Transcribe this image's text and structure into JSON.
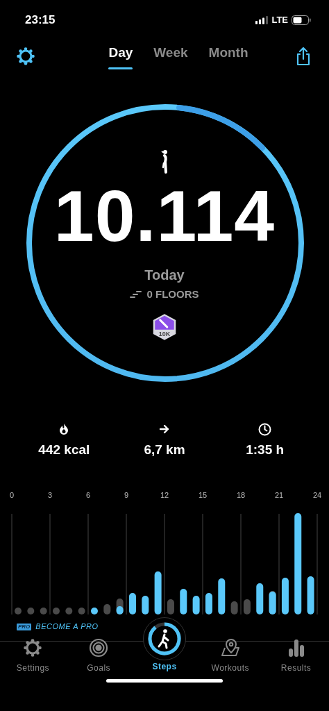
{
  "status_bar": {
    "time": "23:15",
    "network": "LTE"
  },
  "tabs": [
    {
      "label": "Day",
      "selected": true
    },
    {
      "label": "Week",
      "selected": false
    },
    {
      "label": "Month",
      "selected": false
    }
  ],
  "summary": {
    "steps": "10.114",
    "period": "Today",
    "floors": "0 FLOORS",
    "badge": "10K"
  },
  "stats": [
    {
      "kind": "energy",
      "value": "442 kcal"
    },
    {
      "kind": "distance",
      "value": "6,7 km"
    },
    {
      "kind": "time",
      "value": "1:35 h"
    }
  ],
  "hourly_chart": {
    "hour_labels": [
      "0",
      "3",
      "6",
      "9",
      "12",
      "15",
      "18",
      "21",
      "24"
    ]
  },
  "promo": {
    "badge": "PRO",
    "text": "BECOME A PRO"
  },
  "nav": [
    {
      "kind": "settings",
      "label": "Settings",
      "selected": false
    },
    {
      "kind": "goals",
      "label": "Goals",
      "selected": false
    },
    {
      "kind": "steps",
      "label": "Steps",
      "selected": true
    },
    {
      "kind": "workouts",
      "label": "Workouts",
      "selected": false
    },
    {
      "kind": "results",
      "label": "Results",
      "selected": false
    }
  ]
}
